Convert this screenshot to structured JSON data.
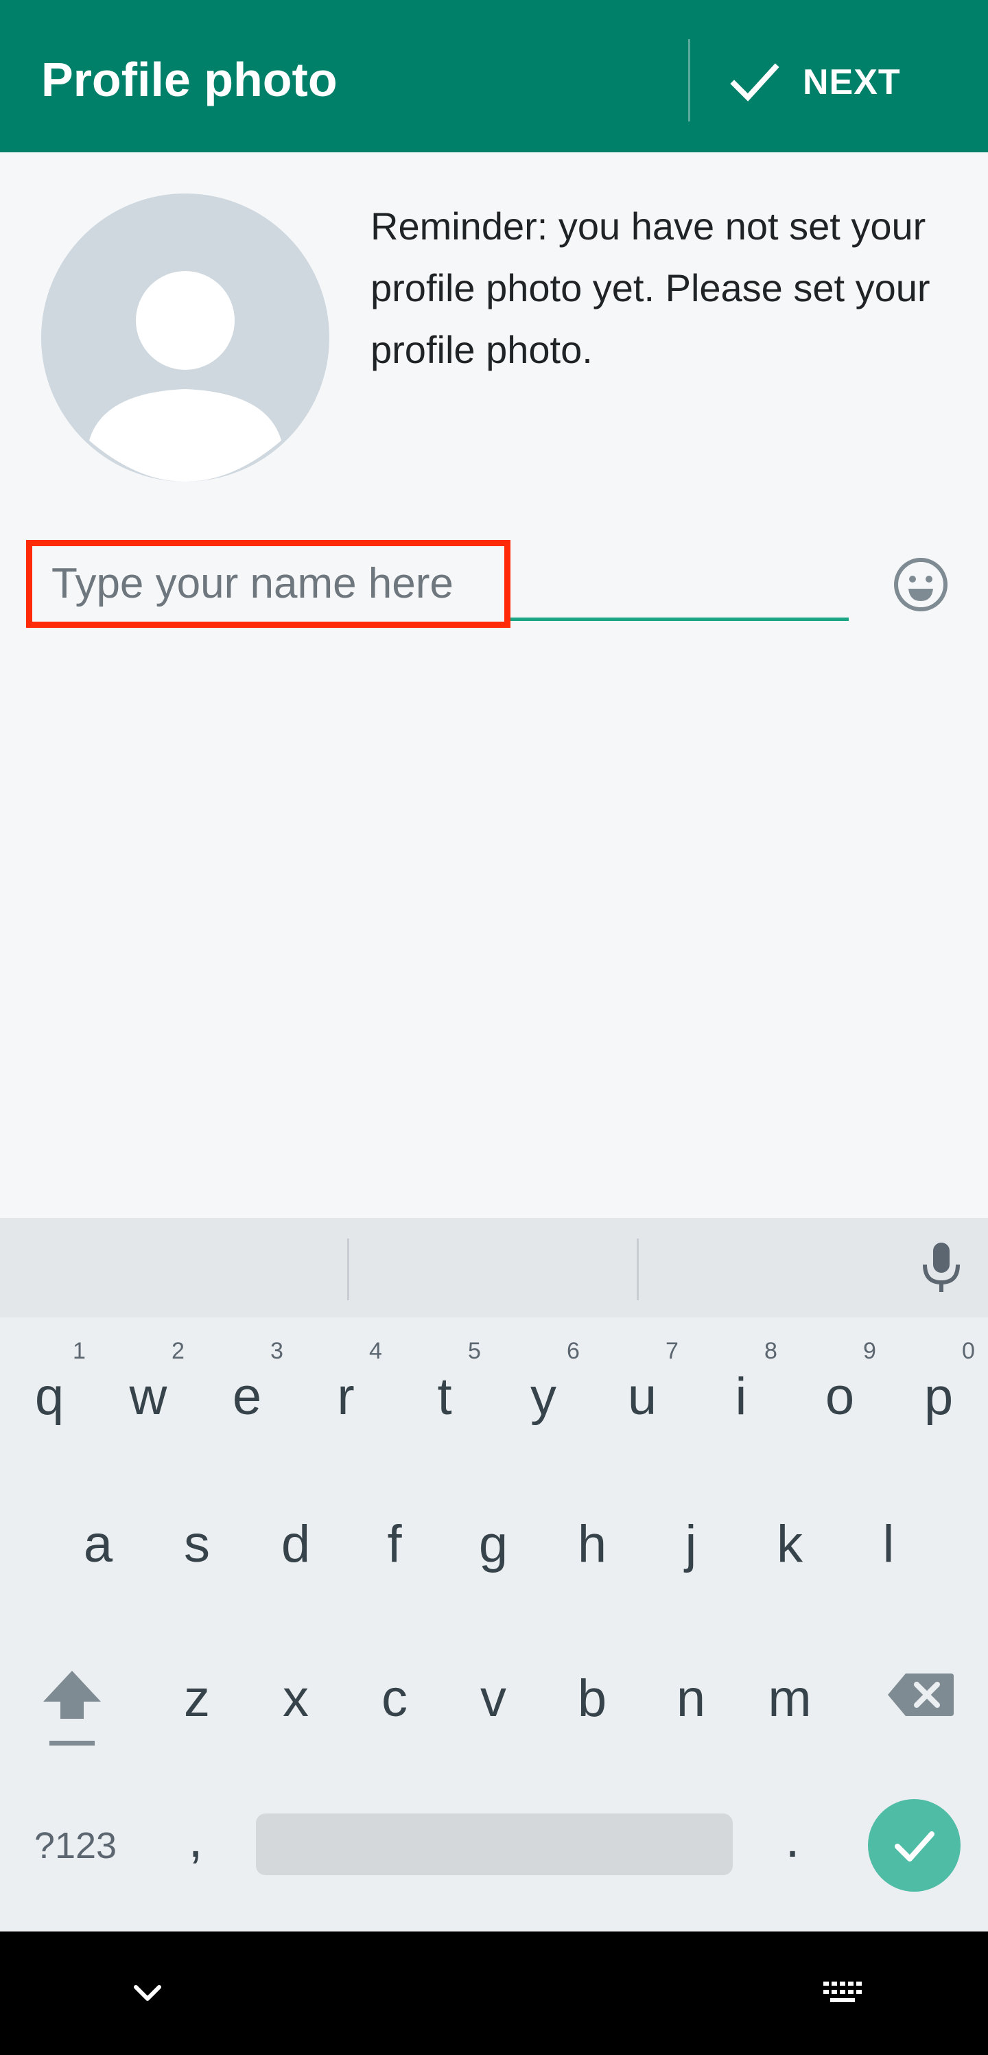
{
  "appbar": {
    "title": "Profile photo",
    "next_label": "NEXT",
    "color": "#018069"
  },
  "profile": {
    "reminder": "Reminder: you have not set your profile photo yet. Please set your profile photo."
  },
  "name_field": {
    "placeholder": "Type your name here",
    "value": ""
  },
  "keyboard": {
    "row1": [
      {
        "key": "q",
        "hint": "1"
      },
      {
        "key": "w",
        "hint": "2"
      },
      {
        "key": "e",
        "hint": "3"
      },
      {
        "key": "r",
        "hint": "4"
      },
      {
        "key": "t",
        "hint": "5"
      },
      {
        "key": "y",
        "hint": "6"
      },
      {
        "key": "u",
        "hint": "7"
      },
      {
        "key": "i",
        "hint": "8"
      },
      {
        "key": "o",
        "hint": "9"
      },
      {
        "key": "p",
        "hint": "0"
      }
    ],
    "row2": [
      "a",
      "s",
      "d",
      "f",
      "g",
      "h",
      "j",
      "k",
      "l"
    ],
    "row3": [
      "z",
      "x",
      "c",
      "v",
      "b",
      "n",
      "m"
    ],
    "symbols_label": "?123",
    "comma": ",",
    "period": ".",
    "accent_color": "#4fbca6"
  },
  "icons": {
    "next": "check-icon",
    "emoji": "smiley-icon",
    "mic": "microphone-icon",
    "shift": "shift-arrow-icon",
    "backspace": "backspace-icon",
    "enter": "check-icon",
    "nav_down": "chevron-down-icon",
    "nav_keyboard": "keyboard-icon"
  }
}
